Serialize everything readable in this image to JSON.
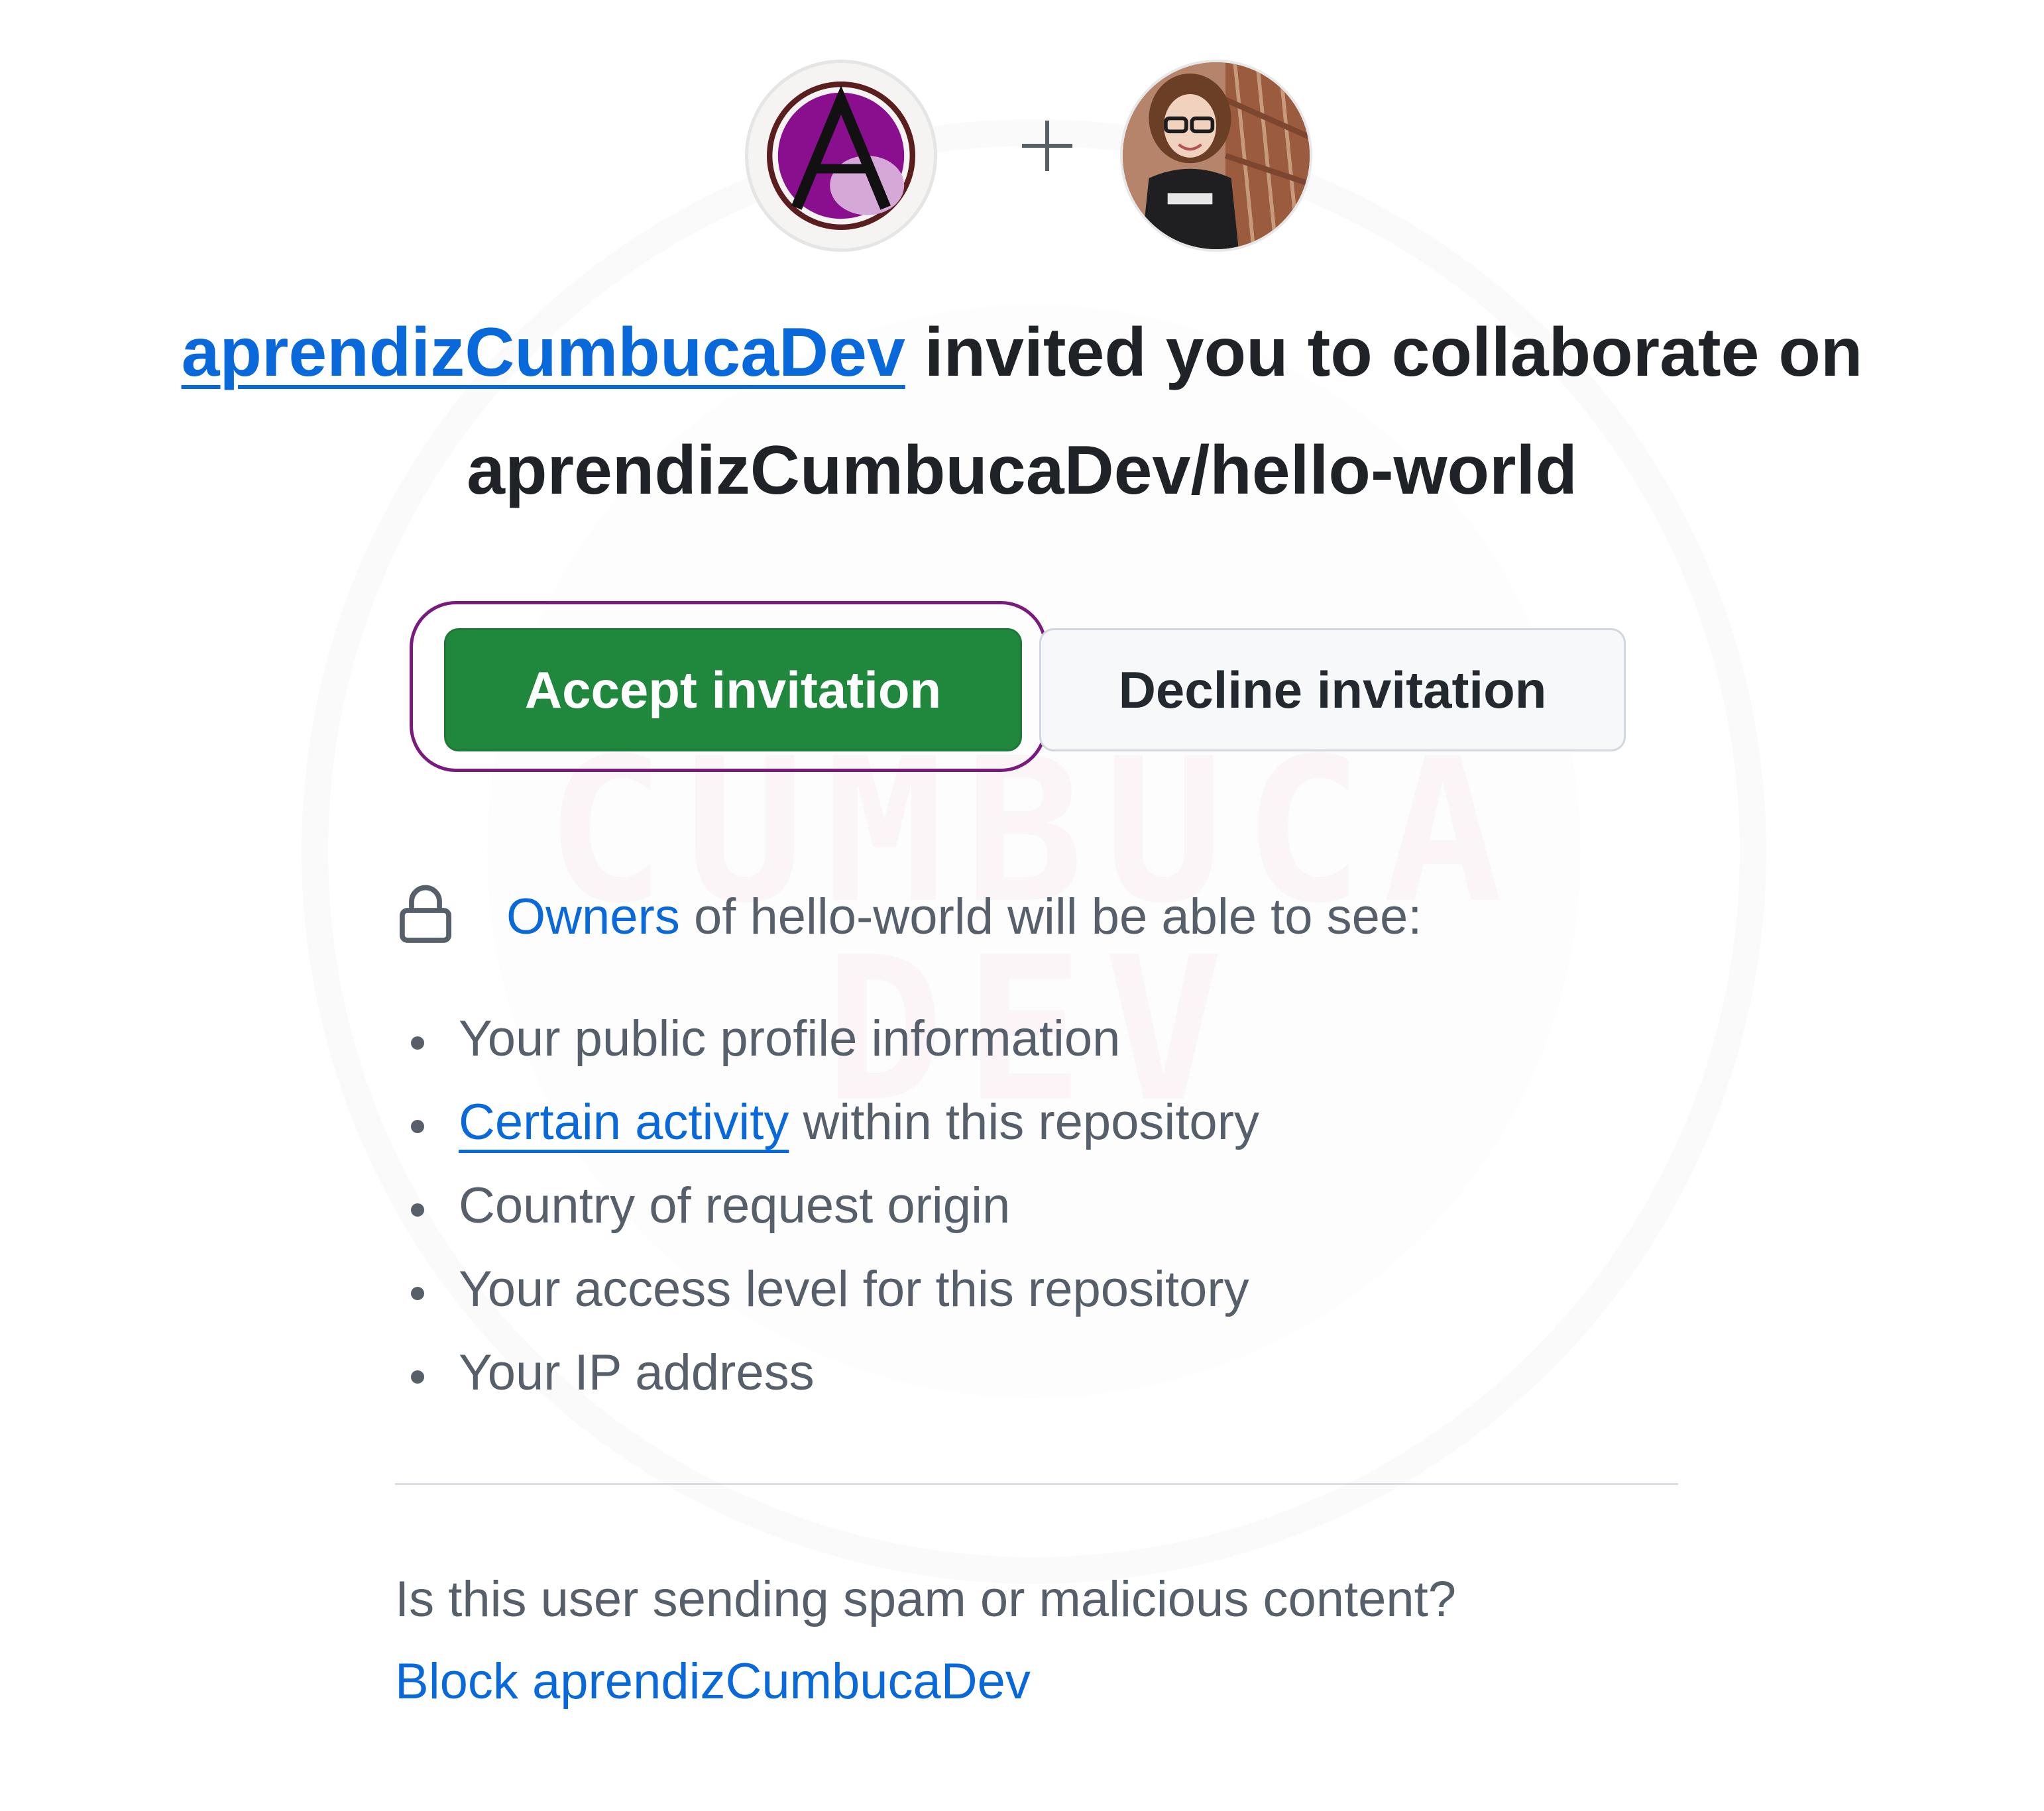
{
  "header": {
    "inviter": "aprendizCumbucaDev",
    "invite_text": "invited you to collaborate on",
    "repository": "aprendizCumbucaDev/hello-world"
  },
  "actions": {
    "accept_label": "Accept invitation",
    "decline_label": "Decline invitation"
  },
  "visibility": {
    "owners_link": "Owners",
    "owners_text": "of hello-world will be able to see:",
    "items": [
      {
        "text": "Your public profile information"
      },
      {
        "link": "Certain activity",
        "text": "within this repository"
      },
      {
        "text": "Country of request origin"
      },
      {
        "text": "Your access level for this repository"
      },
      {
        "text": "Your IP address"
      }
    ]
  },
  "report": {
    "question": "Is this user sending spam or malicious content?",
    "block_label": "Block aprendizCumbucaDev"
  },
  "watermark": {
    "text": "CUMBUCA DEV"
  },
  "icons": {
    "org_avatar": "org-avatar-letter-a",
    "user_avatar": "user-avatar-photo",
    "plus": "plus-icon",
    "lock": "lock-icon"
  },
  "colors": {
    "accept_bg": "#1f883d",
    "link": "#0969da",
    "highlight_ring": "#7b1a7e",
    "text_muted": "#57606a",
    "text_primary": "#1f2328"
  }
}
